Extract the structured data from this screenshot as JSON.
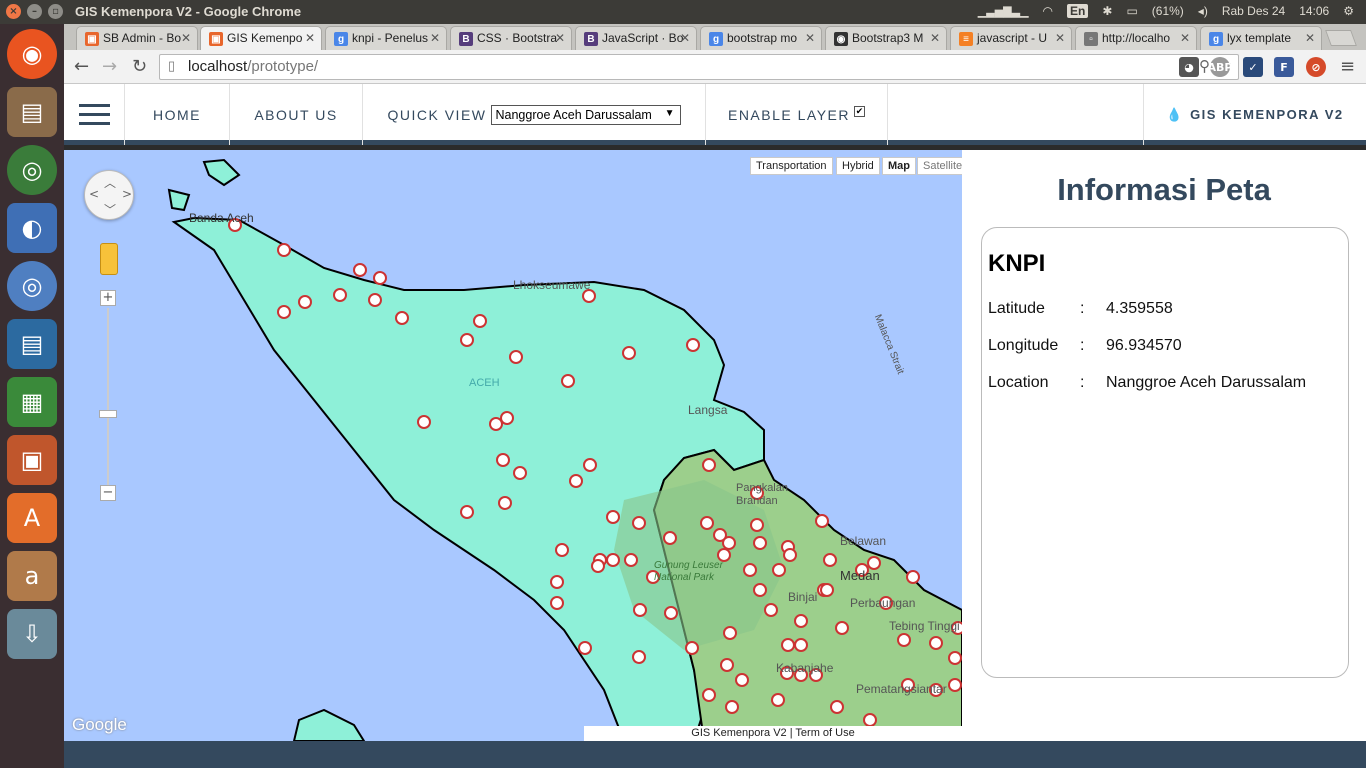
{
  "os": {
    "window_title": "GIS Kemenpora V2 - Google Chrome",
    "lang": "En",
    "battery": "(61%)",
    "date": "Rab Des 24",
    "time": "14:06"
  },
  "tabs": [
    {
      "label": "SB Admin - Bo",
      "favicon": "bootstrap-orange",
      "color": "#e8662c"
    },
    {
      "label": "GIS Kemenpo",
      "favicon": "bootstrap-orange",
      "color": "#e8662c",
      "active": true
    },
    {
      "label": "knpi - Penelus",
      "favicon": "google",
      "color": "#4a86e8"
    },
    {
      "label": "CSS · Bootstra",
      "favicon": "bootstrap",
      "color": "#563d7c"
    },
    {
      "label": "JavaScript · Bo",
      "favicon": "bootstrap",
      "color": "#563d7c"
    },
    {
      "label": "bootstrap mo",
      "favicon": "google",
      "color": "#4a86e8"
    },
    {
      "label": "Bootstrap3 M",
      "favicon": "github",
      "color": "#333333"
    },
    {
      "label": "javascript - U",
      "favicon": "stackoverflow",
      "color": "#f48024"
    },
    {
      "label": "http://localho",
      "favicon": "page",
      "color": "#777777"
    },
    {
      "label": "lyx template",
      "favicon": "google",
      "color": "#4a86e8"
    }
  ],
  "address": {
    "host": "localhost",
    "path": "/prototype/"
  },
  "header": {
    "home": "HOME",
    "about": "ABOUT US",
    "quick_view_label": "QUICK VIEW",
    "quick_view_value": "Nanggroe Aceh Darussalam",
    "enable_layer": "ENABLE LAYER",
    "enable_layer_checked": true,
    "brand": "GIS KEMENPORA V2"
  },
  "map": {
    "type_buttons": [
      "Transportation",
      "Hybrid",
      "Map",
      "Satellite"
    ],
    "active_type": "Map",
    "labels": [
      "Banda Aceh",
      "Lhokseumawe",
      "ACEH",
      "Langsa",
      "Malacca Strait",
      "Pangkalan Brandan",
      "Belawan",
      "Medan",
      "Binjai",
      "Perbaungan",
      "Tebing Tinggi",
      "Pematangsiantar",
      "Gunung Leuser National Park",
      "Kabanjahe"
    ],
    "logo": "Google",
    "footer": "GIS Kemenpora V2 | Term of Use"
  },
  "info": {
    "title": "Informasi Peta",
    "name": "KNPI",
    "rows": [
      {
        "key": "Latitude",
        "sep": ":",
        "value": "4.359558"
      },
      {
        "key": "Longitude",
        "sep": ":",
        "value": "96.934570"
      },
      {
        "key": "Location",
        "sep": ":",
        "value": "Nanggroe Aceh Darussalam"
      }
    ]
  }
}
